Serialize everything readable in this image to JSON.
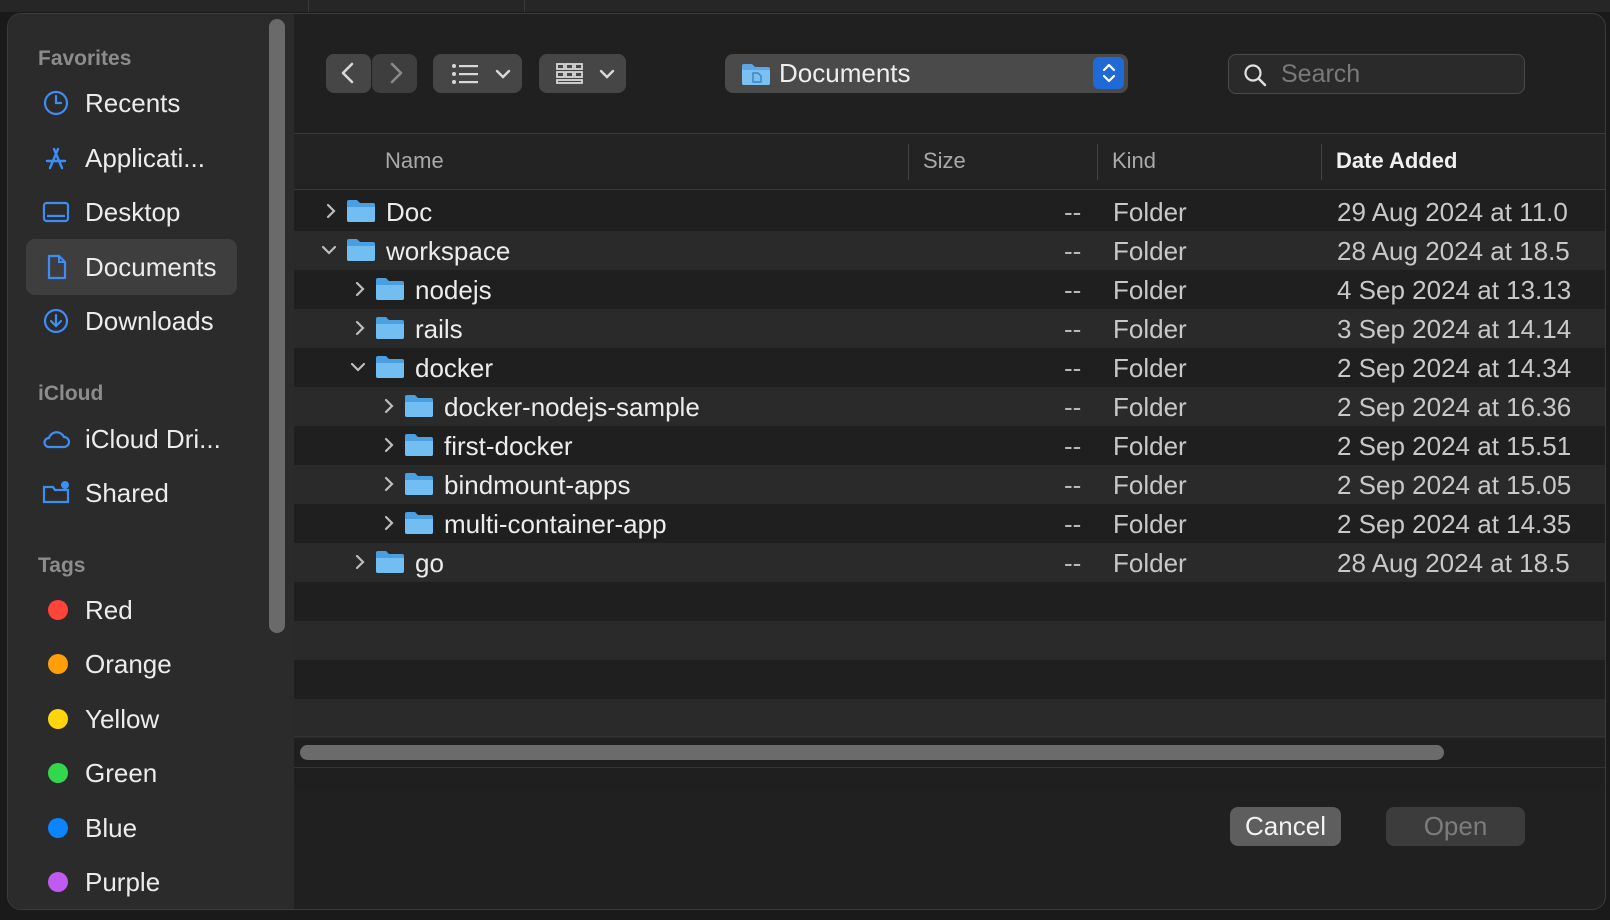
{
  "sidebar": {
    "favorites_header": "Favorites",
    "favorites": [
      {
        "label": "Recents",
        "icon": "clock-icon"
      },
      {
        "label": "Applicati...",
        "icon": "applications-icon"
      },
      {
        "label": "Desktop",
        "icon": "desktop-icon"
      },
      {
        "label": "Documents",
        "icon": "document-icon",
        "selected": true
      },
      {
        "label": "Downloads",
        "icon": "download-icon"
      }
    ],
    "icloud_header": "iCloud",
    "icloud": [
      {
        "label": "iCloud Dri...",
        "icon": "cloud-icon"
      },
      {
        "label": "Shared",
        "icon": "shared-folder-icon"
      }
    ],
    "tags_header": "Tags",
    "tags": [
      {
        "label": "Red",
        "color": "#ff453a"
      },
      {
        "label": "Orange",
        "color": "#ff9f0a"
      },
      {
        "label": "Yellow",
        "color": "#ffd60a"
      },
      {
        "label": "Green",
        "color": "#32d74b"
      },
      {
        "label": "Blue",
        "color": "#0a84ff"
      },
      {
        "label": "Purple",
        "color": "#bf5af2"
      }
    ]
  },
  "toolbar": {
    "path_label": "Documents",
    "search_placeholder": "Search"
  },
  "table": {
    "columns": {
      "name": "Name",
      "size": "Size",
      "kind": "Kind",
      "date": "Date Added"
    },
    "rows": [
      {
        "name": "Doc",
        "size": "--",
        "kind": "Folder",
        "date": "29 Aug 2024 at 11.0",
        "level": 0,
        "expanded": false
      },
      {
        "name": "workspace",
        "size": "--",
        "kind": "Folder",
        "date": "28 Aug 2024 at 18.5",
        "level": 0,
        "expanded": true
      },
      {
        "name": "nodejs",
        "size": "--",
        "kind": "Folder",
        "date": "4 Sep 2024 at 13.13",
        "level": 1,
        "expanded": false
      },
      {
        "name": "rails",
        "size": "--",
        "kind": "Folder",
        "date": "3 Sep 2024 at 14.14",
        "level": 1,
        "expanded": false
      },
      {
        "name": "docker",
        "size": "--",
        "kind": "Folder",
        "date": "2 Sep 2024 at 14.34",
        "level": 1,
        "expanded": true
      },
      {
        "name": "docker-nodejs-sample",
        "size": "--",
        "kind": "Folder",
        "date": "2 Sep 2024 at 16.36",
        "level": 2,
        "expanded": false
      },
      {
        "name": "first-docker",
        "size": "--",
        "kind": "Folder",
        "date": "2 Sep 2024 at 15.51",
        "level": 2,
        "expanded": false
      },
      {
        "name": "bindmount-apps",
        "size": "--",
        "kind": "Folder",
        "date": "2 Sep 2024 at 15.05",
        "level": 2,
        "expanded": false
      },
      {
        "name": "multi-container-app",
        "size": "--",
        "kind": "Folder",
        "date": "2 Sep 2024 at 14.35",
        "level": 2,
        "expanded": false
      },
      {
        "name": "go",
        "size": "--",
        "kind": "Folder",
        "date": "28 Aug 2024 at 18.5",
        "level": 1,
        "expanded": false
      }
    ]
  },
  "buttons": {
    "cancel": "Cancel",
    "open": "Open"
  }
}
